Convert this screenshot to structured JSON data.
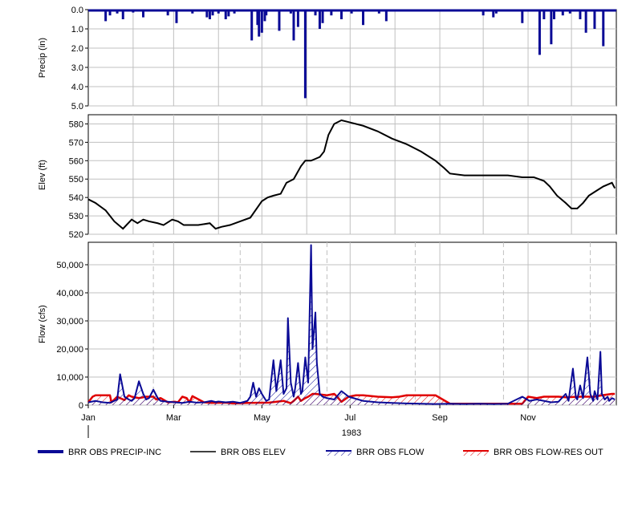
{
  "chart_data": [
    {
      "type": "bar",
      "ylabel": "Precip (in)",
      "ylim": [
        0,
        5
      ],
      "y_inverted": true,
      "yticks": [
        "0.0",
        "1.0",
        "2.0",
        "3.0",
        "4.0",
        "5.0"
      ],
      "grid": true,
      "series": [
        {
          "name": "BRR OBS PRECIP-INC",
          "color": "#0a0a96",
          "x_day": [
            3,
            12,
            15,
            20,
            24,
            31,
            38,
            44,
            55,
            61,
            72,
            77,
            82,
            84,
            86,
            90,
            95,
            97,
            101,
            113,
            117,
            118,
            120,
            122,
            123,
            132,
            140,
            142,
            145,
            150,
            157,
            160,
            162,
            168,
            175,
            182,
            190,
            201,
            206,
            229,
            255,
            268,
            273,
            280,
            282,
            290,
            300,
            312,
            315,
            320,
            322,
            328,
            333,
            340,
            344,
            350,
            356
          ],
          "values": [
            0.05,
            0.6,
            0.3,
            0.2,
            0.5,
            0.15,
            0.4,
            0.1,
            0.3,
            0.7,
            0.2,
            0.1,
            0.4,
            0.5,
            0.3,
            0.2,
            0.5,
            0.35,
            0.2,
            1.6,
            0.8,
            1.4,
            1.2,
            0.6,
            0.3,
            1.1,
            0.2,
            1.6,
            0.9,
            4.6,
            0.3,
            1.0,
            0.7,
            0.3,
            0.5,
            0.2,
            0.8,
            0.2,
            0.6,
            0.1,
            0.05,
            0.1,
            0.3,
            0.4,
            0.2,
            0.1,
            0.7,
            2.35,
            0.5,
            1.8,
            0.5,
            0.3,
            0.2,
            0.5,
            1.2,
            1.0,
            1.9
          ]
        }
      ]
    },
    {
      "type": "line",
      "ylabel": "Elev (ft)",
      "ylim": [
        520,
        585
      ],
      "yticks": [
        520,
        530,
        540,
        550,
        560,
        570,
        580
      ],
      "grid": true,
      "series": [
        {
          "name": "BRR OBS ELEV",
          "color": "#000000",
          "x_day": [
            0,
            5,
            12,
            18,
            24,
            30,
            34,
            38,
            42,
            48,
            52,
            58,
            62,
            66,
            70,
            76,
            84,
            88,
            92,
            98,
            105,
            112,
            120,
            124,
            128,
            133,
            137,
            142,
            147,
            150,
            154,
            157,
            160,
            163,
            166,
            170,
            175,
            180,
            190,
            200,
            210,
            220,
            230,
            240,
            246,
            250,
            260,
            270,
            280,
            290,
            300,
            308,
            315,
            319,
            324,
            330,
            334,
            338,
            342,
            346,
            350,
            356,
            362,
            364
          ],
          "values": [
            539,
            537,
            533,
            527,
            523,
            528,
            526,
            528,
            527,
            526,
            525,
            528,
            527,
            525,
            525,
            525,
            526,
            523,
            524,
            525,
            527,
            529,
            538,
            540,
            541,
            542,
            548,
            550,
            557,
            560,
            560,
            561,
            562,
            565,
            574,
            580,
            582,
            581,
            579,
            576,
            572,
            569,
            565,
            560,
            556,
            553,
            552,
            552,
            552,
            552,
            551,
            551,
            549,
            546,
            541,
            537,
            534,
            534,
            537,
            541,
            543,
            546,
            548,
            545
          ]
        }
      ]
    },
    {
      "type": "area",
      "ylabel": "Flow (cfs)",
      "ylim": [
        0,
        58000
      ],
      "yticks": [
        "0",
        "10,000",
        "20,000",
        "30,000",
        "40,000",
        "50,000"
      ],
      "grid": true,
      "x_title": "1983",
      "xticks": [
        "Jan",
        "Mar",
        "May",
        "Jul",
        "Sep",
        "Nov"
      ],
      "series": [
        {
          "name": "BRR OBS FLOW",
          "color": "#0a0a96",
          "hatched": true,
          "x_day": [
            0,
            5,
            10,
            15,
            20,
            22,
            25,
            28,
            30,
            32,
            35,
            38,
            40,
            42,
            45,
            48,
            50,
            55,
            60,
            65,
            70,
            75,
            80,
            85,
            88,
            90,
            95,
            100,
            105,
            110,
            112,
            114,
            116,
            118,
            120,
            123,
            125,
            128,
            130,
            133,
            135,
            137,
            138,
            140,
            142,
            143,
            145,
            147,
            148,
            150,
            152,
            154,
            155,
            157,
            158,
            160,
            162,
            165,
            170,
            175,
            180,
            190,
            200,
            210,
            220,
            230,
            240,
            250,
            260,
            270,
            280,
            290,
            300,
            305,
            310,
            315,
            320,
            325,
            330,
            332,
            335,
            337,
            338,
            340,
            342,
            345,
            347,
            349,
            350,
            352,
            354,
            355,
            357,
            359,
            360,
            362,
            364
          ],
          "values": [
            1000,
            1500,
            1000,
            800,
            2000,
            11000,
            3000,
            2000,
            1500,
            2500,
            8500,
            4000,
            2000,
            2500,
            5500,
            2500,
            1500,
            1200,
            1000,
            800,
            1200,
            900,
            1000,
            1500,
            1100,
            1300,
            1000,
            1200,
            800,
            1500,
            3000,
            8000,
            3000,
            6000,
            4000,
            1500,
            2000,
            16000,
            5000,
            16000,
            4000,
            6000,
            31000,
            8000,
            3000,
            6000,
            15000,
            4000,
            5000,
            17000,
            8000,
            57000,
            20000,
            33000,
            15000,
            4000,
            3000,
            2500,
            2000,
            5000,
            3000,
            1500,
            1000,
            800,
            600,
            500,
            400,
            500,
            400,
            500,
            400,
            500,
            3000,
            1500,
            2000,
            1500,
            1000,
            1200,
            4000,
            1500,
            13000,
            3000,
            2000,
            7000,
            2500,
            17000,
            4000,
            1500,
            5000,
            2000,
            19000,
            4000,
            2000,
            3000,
            1500,
            2500,
            2000
          ]
        },
        {
          "name": "BRR OBS FLOW-RES OUT",
          "color": "#e00000",
          "hatched": true,
          "x_day": [
            0,
            3,
            5,
            15,
            16,
            20,
            22,
            25,
            28,
            30,
            35,
            40,
            45,
            47,
            50,
            55,
            60,
            62,
            65,
            68,
            70,
            72,
            80,
            85,
            95,
            100,
            110,
            125,
            135,
            140,
            142,
            145,
            147,
            150,
            152,
            155,
            157,
            165,
            170,
            172,
            175,
            180,
            185,
            190,
            200,
            210,
            215,
            220,
            230,
            240,
            250,
            260,
            270,
            280,
            290,
            300,
            304,
            310,
            315,
            318,
            325,
            330,
            340,
            350,
            355,
            362,
            364
          ],
          "values": [
            1000,
            3000,
            3500,
            3500,
            1000,
            3000,
            2500,
            1800,
            3500,
            3000,
            2500,
            3000,
            3000,
            2000,
            2500,
            1000,
            1200,
            1000,
            3000,
            2500,
            1000,
            3200,
            1000,
            800,
            900,
            600,
            800,
            900,
            1500,
            700,
            1500,
            3000,
            1500,
            2500,
            3000,
            4000,
            4000,
            3500,
            4000,
            3000,
            1200,
            3000,
            3500,
            3500,
            3000,
            2800,
            3000,
            3500,
            3500,
            3500,
            500,
            500,
            500,
            500,
            500,
            500,
            3000,
            2500,
            3000,
            3000,
            3000,
            2800,
            3000,
            3000,
            3500,
            4000,
            4000
          ]
        }
      ]
    }
  ],
  "legend": {
    "items": [
      {
        "label": "BRR OBS PRECIP-INC",
        "color": "#0a0a96",
        "style": "thick"
      },
      {
        "label": "BRR OBS ELEV",
        "color": "#000000",
        "style": "line"
      },
      {
        "label": "BRR OBS FLOW",
        "color": "#0a0a96",
        "style": "hatched"
      },
      {
        "label": "BRR OBS FLOW-RES OUT",
        "color": "#e00000",
        "style": "hatched"
      }
    ]
  }
}
